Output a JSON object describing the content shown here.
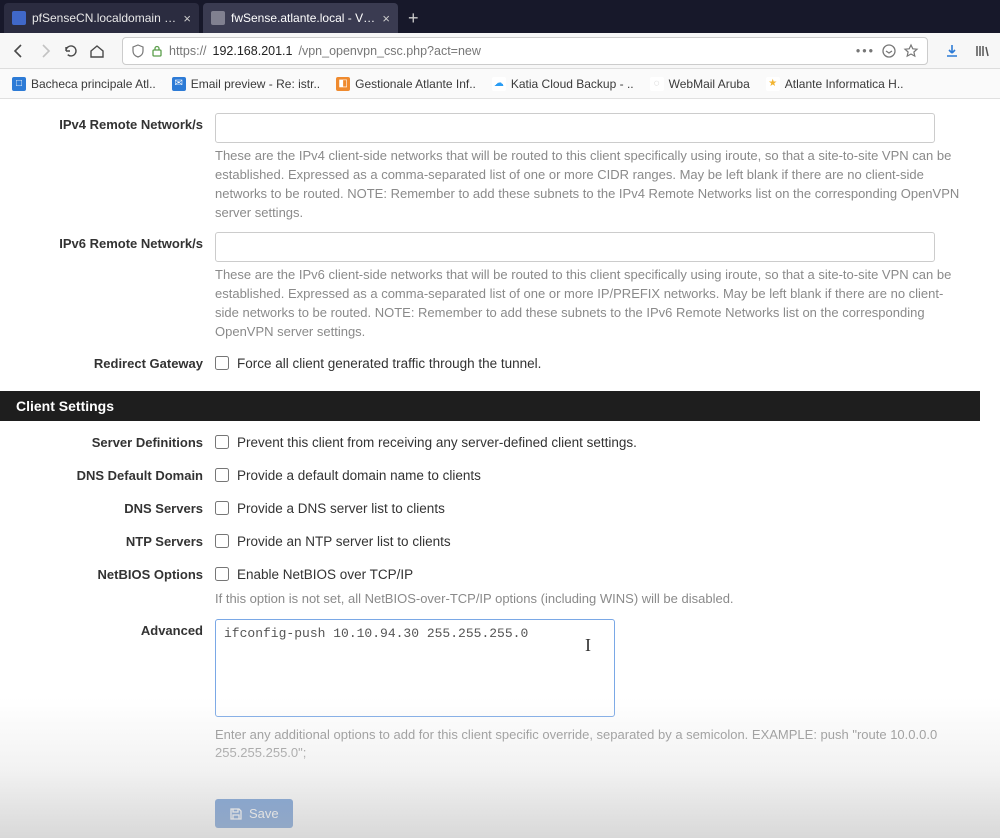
{
  "browser": {
    "tabs": [
      {
        "title": "pfSenseCN.localdomain - VPN"
      },
      {
        "title": "fwSense.atlante.local - VPN: O"
      }
    ],
    "url_prefix": "https://",
    "url_host": "192.168.201.1",
    "url_path": "/vpn_openvpn_csc.php?act=new",
    "bookmarks": [
      {
        "label": "Bacheca principale Atl..",
        "color": "#2d7bd6"
      },
      {
        "label": "Email preview - Re: istr..",
        "color": "#2d7bd6"
      },
      {
        "label": "Gestionale Atlante Inf..",
        "color": "#ef8a2e"
      },
      {
        "label": "Katia Cloud Backup - ..",
        "color": "#2a9df4"
      },
      {
        "label": "WebMail Aruba",
        "color": "#bdbdbd"
      },
      {
        "label": "Atlante Informatica H..",
        "color": "#f2b431"
      }
    ]
  },
  "fields": {
    "ipv4": {
      "label": "IPv4 Remote Network/s",
      "value": "",
      "help": "These are the IPv4 client-side networks that will be routed to this client specifically using iroute, so that a site-to-site VPN can be established. Expressed as a comma-separated list of one or more CIDR ranges. May be left blank if there are no client-side networks to be routed. NOTE: Remember to add these subnets to the IPv4 Remote Networks list on the corresponding OpenVPN server settings."
    },
    "ipv6": {
      "label": "IPv6 Remote Network/s",
      "value": "",
      "help": "These are the IPv6 client-side networks that will be routed to this client specifically using iroute, so that a site-to-site VPN can be established. Expressed as a comma-separated list of one or more IP/PREFIX networks. May be left blank if there are no client-side networks to be routed. NOTE: Remember to add these subnets to the IPv6 Remote Networks list on the corresponding OpenVPN server settings."
    },
    "redirect": {
      "label": "Redirect Gateway",
      "text": "Force all client generated traffic through the tunnel."
    }
  },
  "section_hdr": "Client Settings",
  "settings": {
    "serverdef": {
      "label": "Server Definitions",
      "text": "Prevent this client from receiving any server-defined client settings."
    },
    "dnsdom": {
      "label": "DNS Default Domain",
      "text": "Provide a default domain name to clients"
    },
    "dnssrv": {
      "label": "DNS Servers",
      "text": "Provide a DNS server list to clients"
    },
    "ntp": {
      "label": "NTP Servers",
      "text": "Provide an NTP server list to clients"
    },
    "netbios": {
      "label": "NetBIOS Options",
      "text": "Enable NetBIOS over TCP/IP",
      "help": "If this option is not set, all NetBIOS-over-TCP/IP options (including WINS) will be disabled."
    },
    "advanced": {
      "label": "Advanced",
      "value": "ifconfig-push 10.10.94.30 255.255.255.0",
      "help": "Enter any additional options to add for this client specific override, separated by a semicolon. EXAMPLE: push \"route 10.0.0.0 255.255.255.0\";"
    }
  },
  "save_label": "Save"
}
